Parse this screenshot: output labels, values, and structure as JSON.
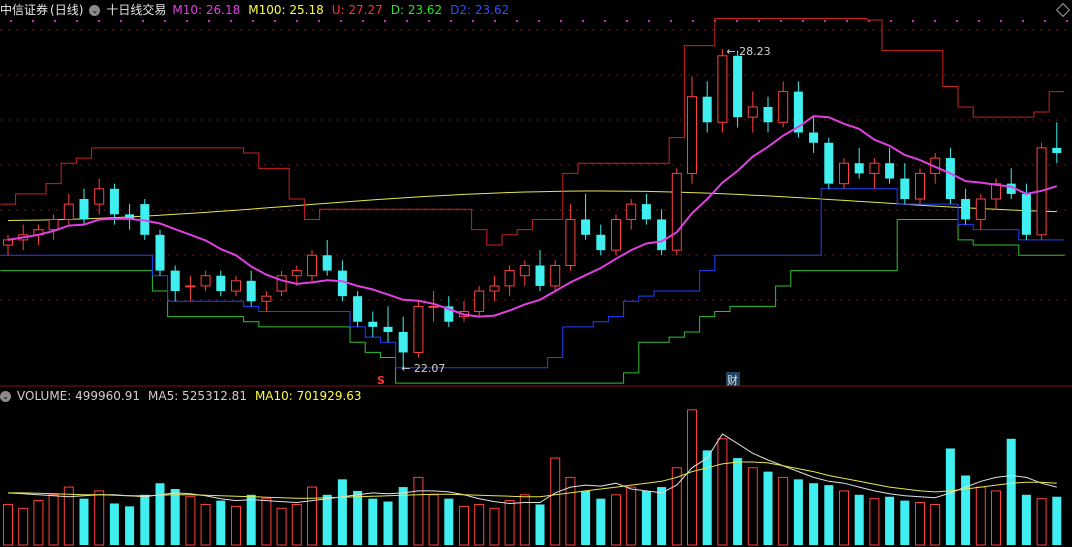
{
  "header": {
    "title": "中信证券",
    "period": "(日线)",
    "indicator_name": "十日线交易",
    "indicators": [
      {
        "label": "M10: 26.18",
        "color": "#e040e0"
      },
      {
        "label": "M100: 25.18",
        "color": "#ffff40"
      },
      {
        "label": "U: 27.27",
        "color": "#ff3030"
      },
      {
        "label": "D: 23.62",
        "color": "#30e030"
      },
      {
        "label": "D2: 23.62",
        "color": "#3050ff"
      }
    ]
  },
  "volume_header": {
    "items": [
      {
        "label": "VOLUME: 499960.91",
        "color": "#d0d0d0"
      },
      {
        "label": "MA5: 525312.81",
        "color": "#d0d0d0"
      },
      {
        "label": "MA10: 701929.63",
        "color": "#ffff40"
      }
    ]
  },
  "annotations": {
    "high": "28.23",
    "low": "22.07",
    "marker_s": "S",
    "marker_cai": "财"
  },
  "colors": {
    "up": "#ff4040",
    "down": "#40f0f0",
    "ma10": "#e040e0",
    "ma100": "#e6e64a",
    "upper": "#cc2020",
    "lower_green": "#30c030",
    "lower_blue": "#2040ff",
    "grid": "#7a1515"
  },
  "chart_data": {
    "type": "candlestick",
    "n_bars": 70,
    "price_range": [
      21.8,
      28.8
    ],
    "candles": [
      [
        24.4,
        24.6,
        24.2,
        24.5
      ],
      [
        24.5,
        24.8,
        24.3,
        24.6
      ],
      [
        24.6,
        24.8,
        24.4,
        24.7
      ],
      [
        24.7,
        25.0,
        24.5,
        24.9
      ],
      [
        24.9,
        25.4,
        24.8,
        25.2
      ],
      [
        25.3,
        25.5,
        24.8,
        24.9
      ],
      [
        25.2,
        25.7,
        25.0,
        25.5
      ],
      [
        25.5,
        25.6,
        24.8,
        25.0
      ],
      [
        25.0,
        25.2,
        24.7,
        24.9
      ],
      [
        25.2,
        25.3,
        24.5,
        24.6
      ],
      [
        24.6,
        24.7,
        23.8,
        23.9
      ],
      [
        23.9,
        24.0,
        23.3,
        23.5
      ],
      [
        23.6,
        23.8,
        23.3,
        23.6
      ],
      [
        23.6,
        23.9,
        23.5,
        23.8
      ],
      [
        23.8,
        23.9,
        23.4,
        23.5
      ],
      [
        23.5,
        23.8,
        23.4,
        23.7
      ],
      [
        23.7,
        23.9,
        23.2,
        23.3
      ],
      [
        23.3,
        23.5,
        23.1,
        23.4
      ],
      [
        23.5,
        23.9,
        23.4,
        23.8
      ],
      [
        23.8,
        24.0,
        23.6,
        23.9
      ],
      [
        23.8,
        24.3,
        23.7,
        24.2
      ],
      [
        24.2,
        24.5,
        23.8,
        23.9
      ],
      [
        23.9,
        24.1,
        23.3,
        23.4
      ],
      [
        23.4,
        23.5,
        22.8,
        22.9
      ],
      [
        22.9,
        23.1,
        22.6,
        22.8
      ],
      [
        22.8,
        23.2,
        22.5,
        22.7
      ],
      [
        22.7,
        23.0,
        22.0,
        22.3
      ],
      [
        22.3,
        23.3,
        22.2,
        23.2
      ],
      [
        23.2,
        23.5,
        22.9,
        23.2
      ],
      [
        23.2,
        23.4,
        22.8,
        22.9
      ],
      [
        23.0,
        23.3,
        22.9,
        23.1
      ],
      [
        23.1,
        23.6,
        23.0,
        23.5
      ],
      [
        23.5,
        23.8,
        23.3,
        23.6
      ],
      [
        23.6,
        24.0,
        23.4,
        23.9
      ],
      [
        23.8,
        24.1,
        23.6,
        24.0
      ],
      [
        24.0,
        24.3,
        23.5,
        23.6
      ],
      [
        23.6,
        24.1,
        23.5,
        24.0
      ],
      [
        24.0,
        25.2,
        23.9,
        24.9
      ],
      [
        24.9,
        25.4,
        24.5,
        24.6
      ],
      [
        24.6,
        24.8,
        24.2,
        24.3
      ],
      [
        24.3,
        25.0,
        24.2,
        24.9
      ],
      [
        24.9,
        25.3,
        24.7,
        25.2
      ],
      [
        25.2,
        25.4,
        24.8,
        24.9
      ],
      [
        24.9,
        25.1,
        24.2,
        24.3
      ],
      [
        24.3,
        25.9,
        24.2,
        25.8
      ],
      [
        25.8,
        27.7,
        25.6,
        27.3
      ],
      [
        27.3,
        27.6,
        26.6,
        26.8
      ],
      [
        26.8,
        28.23,
        26.6,
        28.1
      ],
      [
        28.1,
        28.2,
        26.7,
        26.9
      ],
      [
        26.9,
        27.4,
        26.6,
        27.1
      ],
      [
        27.1,
        27.3,
        26.6,
        26.8
      ],
      [
        26.8,
        27.6,
        26.7,
        27.4
      ],
      [
        27.4,
        27.6,
        26.5,
        26.6
      ],
      [
        26.6,
        26.9,
        26.2,
        26.4
      ],
      [
        26.4,
        26.5,
        25.5,
        25.6
      ],
      [
        25.6,
        26.1,
        25.5,
        26.0
      ],
      [
        26.0,
        26.3,
        25.7,
        25.8
      ],
      [
        25.8,
        26.1,
        25.5,
        26.0
      ],
      [
        26.0,
        26.3,
        25.6,
        25.7
      ],
      [
        25.7,
        26.0,
        25.2,
        25.3
      ],
      [
        25.3,
        25.9,
        25.2,
        25.8
      ],
      [
        25.8,
        26.2,
        25.6,
        26.1
      ],
      [
        26.1,
        26.3,
        25.2,
        25.3
      ],
      [
        25.3,
        25.5,
        24.8,
        24.9
      ],
      [
        24.9,
        25.4,
        24.7,
        25.3
      ],
      [
        25.3,
        25.7,
        25.1,
        25.6
      ],
      [
        25.6,
        25.9,
        25.3,
        25.4
      ],
      [
        25.4,
        25.6,
        24.5,
        24.6
      ],
      [
        24.6,
        26.4,
        24.5,
        26.3
      ],
      [
        26.3,
        26.8,
        26.0,
        26.2
      ]
    ],
    "volume_range": [
      0,
      1450000
    ],
    "volumes": [
      420000,
      380000,
      460000,
      520000,
      600000,
      480000,
      560000,
      430000,
      400000,
      520000,
      640000,
      580000,
      500000,
      420000,
      460000,
      400000,
      520000,
      480000,
      380000,
      420000,
      600000,
      520000,
      680000,
      560000,
      480000,
      450000,
      600000,
      700000,
      520000,
      480000,
      400000,
      420000,
      380000,
      460000,
      520000,
      420000,
      900000,
      700000,
      560000,
      480000,
      520000,
      600000,
      560000,
      600000,
      800000,
      1400000,
      980000,
      1100000,
      900000,
      800000,
      760000,
      700000,
      680000,
      640000,
      620000,
      560000,
      520000,
      480000,
      500000,
      460000,
      440000,
      420000,
      1000000,
      720000,
      600000,
      560000,
      1100000,
      520000,
      480000,
      500000
    ],
    "ma5": [
      540000,
      530000,
      520000,
      510000,
      500000,
      510000,
      520000,
      520000,
      510000,
      500000,
      520000,
      540000,
      530000,
      510000,
      480000,
      460000,
      470000,
      460000,
      450000,
      440000,
      460000,
      480000,
      500000,
      520000,
      540000,
      530000,
      540000,
      560000,
      560000,
      550000,
      520000,
      480000,
      450000,
      430000,
      440000,
      440000,
      540000,
      600000,
      620000,
      610000,
      640000,
      580000,
      560000,
      540000,
      620000,
      800000,
      900000,
      1150000,
      1050000,
      950000,
      880000,
      820000,
      760000,
      700000,
      660000,
      640000,
      600000,
      560000,
      530000,
      510000,
      500000,
      490000,
      540000,
      600000,
      660000,
      700000,
      720000,
      700000,
      640000,
      600000
    ],
    "ma10": [
      540000,
      540000,
      535000,
      530000,
      525000,
      520000,
      520000,
      515000,
      510000,
      510000,
      515000,
      520000,
      520000,
      515000,
      510000,
      505000,
      500000,
      495000,
      490000,
      485000,
      485000,
      490000,
      495000,
      500000,
      505000,
      510000,
      515000,
      520000,
      525000,
      525000,
      520000,
      515000,
      510000,
      505000,
      500000,
      500000,
      520000,
      540000,
      560000,
      580000,
      600000,
      620000,
      640000,
      660000,
      700000,
      760000,
      800000,
      840000,
      860000,
      860000,
      850000,
      820000,
      790000,
      760000,
      720000,
      690000,
      660000,
      630000,
      600000,
      580000,
      560000,
      550000,
      560000,
      580000,
      600000,
      620000,
      640000,
      650000,
      650000,
      640000
    ]
  }
}
